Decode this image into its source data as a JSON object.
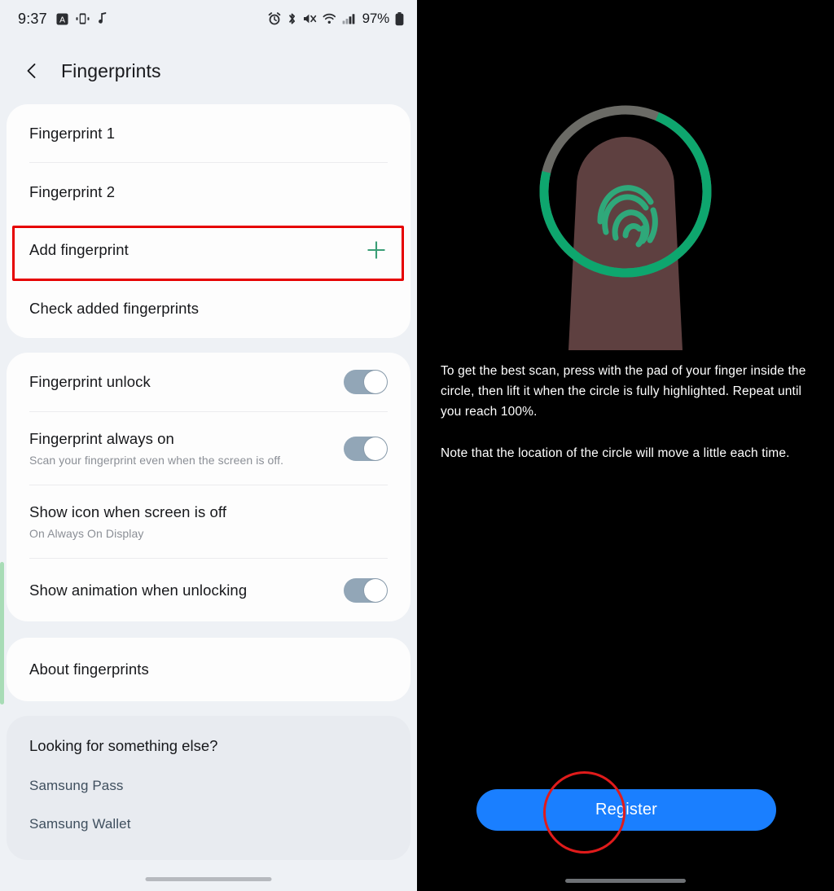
{
  "settings_screen": {
    "status_bar": {
      "time": "9:37",
      "battery_text": "97%",
      "left_icons": [
        "a-badge-icon",
        "device-vibrate-icon",
        "music-note-icon"
      ],
      "right_icons": [
        "alarm-icon",
        "bluetooth-icon",
        "mute-icon",
        "wifi-icon",
        "signal-icon",
        "battery-icon"
      ]
    },
    "app_bar": {
      "back_label": "back-chevron",
      "title": "Fingerprints"
    },
    "fingerprint_card": {
      "items": [
        {
          "title": "Fingerprint 1"
        },
        {
          "title": "Fingerprint 2"
        },
        {
          "title": "Add fingerprint",
          "trailing_icon": "plus-icon",
          "highlighted": true
        },
        {
          "title": "Check added fingerprints"
        }
      ]
    },
    "options_card": {
      "items": [
        {
          "title": "Fingerprint unlock",
          "subtitle": "",
          "toggle": "on"
        },
        {
          "title": "Fingerprint always on",
          "subtitle": "Scan your fingerprint even when the screen is off.",
          "toggle": "on"
        },
        {
          "title": "Show icon when screen is off",
          "subtitle": "On Always On Display",
          "toggle": null
        },
        {
          "title": "Show animation when unlocking",
          "subtitle": "",
          "toggle": "on"
        }
      ]
    },
    "about_card": {
      "items": [
        {
          "title": "About fingerprints"
        }
      ]
    },
    "footer": {
      "heading": "Looking for something else?",
      "links": [
        "Samsung Pass",
        "Samsung Wallet"
      ]
    }
  },
  "register_screen": {
    "graphic": "fingerprint-scan-illustration",
    "instruction_1": "To get the best scan, press with the pad of your finger inside the circle, then lift it when the circle is fully highlighted. Repeat until you reach 100%.",
    "instruction_2": "Note that the location of the circle will move a little each time.",
    "register_button_label": "Register"
  },
  "colors": {
    "accent_green": "#3a9e76",
    "toggle_on": "#92a6b7",
    "annotation_red": "#e60000",
    "register_blue": "#1a7fff",
    "link_slate": "#3f4f5e",
    "page_bg": "#eef1f5",
    "card_bg": "#fdfdfd"
  }
}
